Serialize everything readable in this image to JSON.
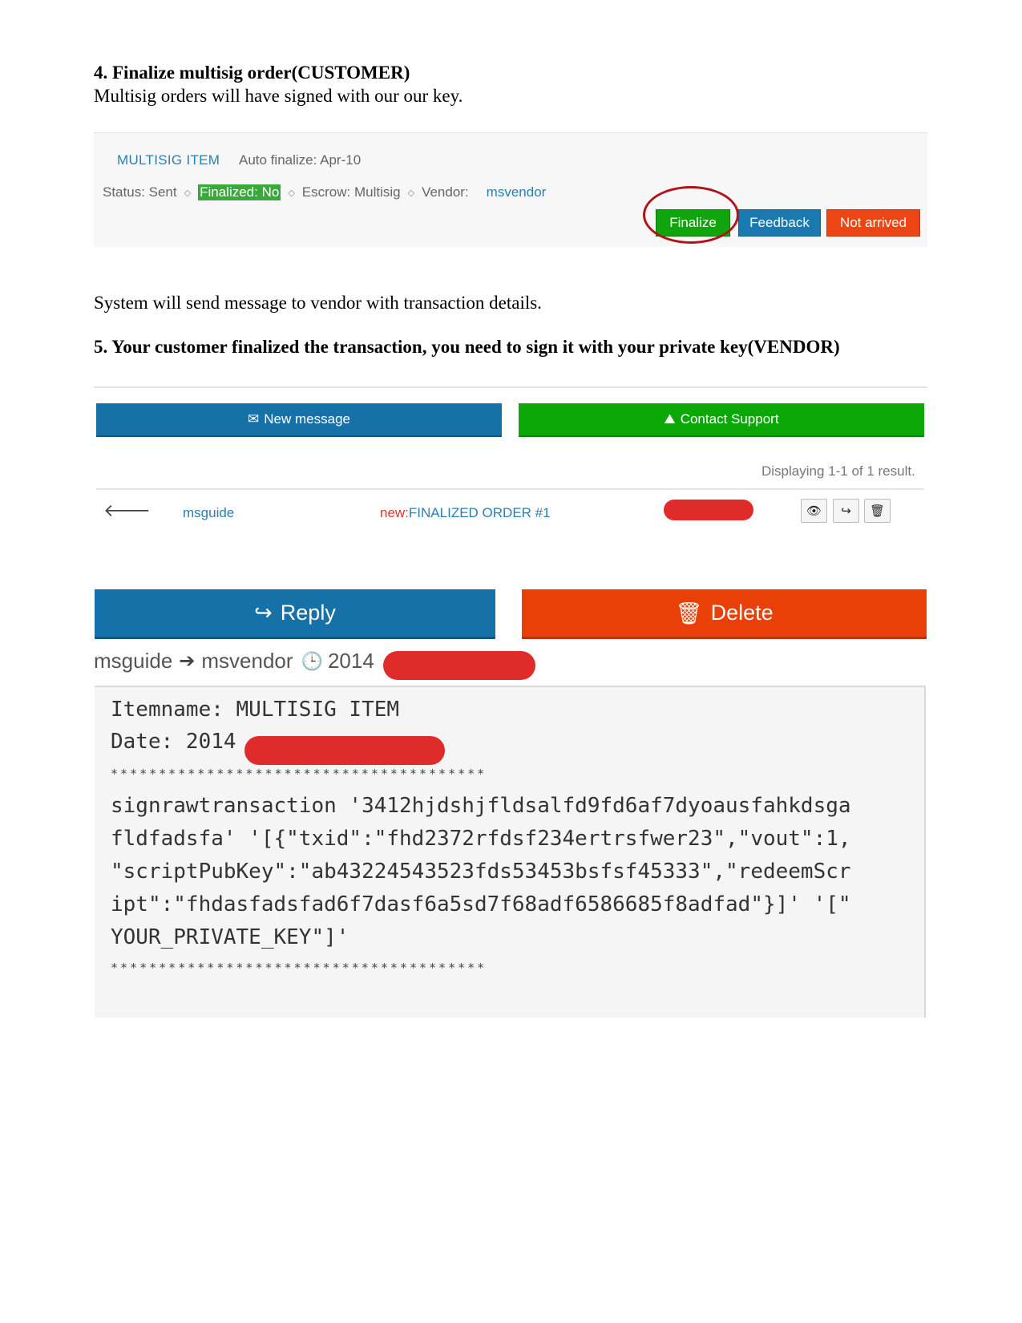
{
  "section4": {
    "heading": "4. Finalize multisig order(CUSTOMER)",
    "text": "Multisig orders will have signed with our our key."
  },
  "order_panel": {
    "item_title": "MULTISIG ITEM",
    "auto_finalize": "Auto finalize: Apr-10",
    "status": "Status: Sent",
    "finalized": "Finalized: No",
    "escrow": "Escrow: Multisig",
    "vendor_label": "Vendor:",
    "vendor": "msvendor",
    "finalize_btn": "Finalize",
    "feedback_btn": "Feedback",
    "not_arrived_btn": "Not arrived"
  },
  "system_text": "System will send message to vendor with transaction details.",
  "section5": {
    "heading": "5. Your customer finalized the transaction, you need to sign it with your private key(VENDOR)"
  },
  "messages": {
    "new_message_btn": "New message",
    "contact_support_btn": "Contact Support",
    "display_count": "Displaying 1-1 of 1 result.",
    "row": {
      "sender": "msguide",
      "new_tag": "new:",
      "subject": "FINALIZED ORDER #1"
    },
    "icons": [
      "arrow-left-icon",
      "eye-icon",
      "share-icon",
      "trash-icon",
      "envelope-icon",
      "road-icon",
      "clock-icon"
    ]
  },
  "message_view": {
    "reply_btn": "Reply",
    "delete_btn": "Delete",
    "from": "msguide",
    "to": "msvendor",
    "date": "2014",
    "body": {
      "itemname": "Itemname: MULTISIG ITEM",
      "date": "Date: 2014",
      "stars": "***************************************",
      "lines": [
        "signrawtransaction '3412hjdshjfldsalfd9fd6af7dyoausfahkdsga",
        "fldfadsfa' '[{\"txid\":\"fhd2372rfdsf234ertrsfwer23\",\"vout\":1,",
        "\"scriptPubKey\":\"ab43224543523fds53453bsfsf45333\",\"redeemScr",
        "ipt\":\"fhdasfadsfad6f7dasf6a5sd7f68adf6586685f8adfad\"}]' '[\"",
        "YOUR_PRIVATE_KEY\"]'"
      ]
    }
  }
}
